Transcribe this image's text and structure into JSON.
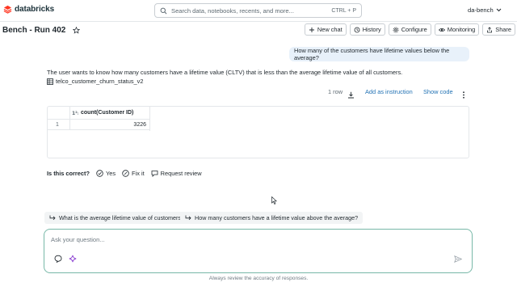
{
  "app": {
    "brand": "databricks",
    "brand_color": "#ff3621",
    "accent_color": "#2272b4"
  },
  "search": {
    "placeholder": "Search data, notebooks, recents, and more...",
    "shortcut": "CTRL + P"
  },
  "workspace": {
    "name": "da-bench",
    "icon": "chevron-down-icon"
  },
  "page": {
    "title": "Bench - Run 402",
    "star_icon": "star-icon"
  },
  "toolbar": {
    "new_chat": "New chat",
    "history": "History",
    "configure": "Configure",
    "monitoring": "Monitoring",
    "share": "Share"
  },
  "chat": {
    "user_question": "How many of the customers have lifetime values below the average?",
    "answer": "The user wants to know how many customers have a lifetime value (CLTV) that is less than the average lifetime value of all customers.",
    "table_ref": "telco_customer_churn_status_v2"
  },
  "result": {
    "row_count": "1 row",
    "add_instruction": "Add as instruction",
    "show_code": "Show code",
    "columns": [
      "count(Customer ID)"
    ],
    "rows": [
      {
        "index": "1",
        "value": "3226"
      }
    ]
  },
  "feedback": {
    "question": "Is this correct?",
    "yes": "Yes",
    "fix": "Fix it",
    "review": "Request review"
  },
  "suggestions": [
    "What is the average lifetime value of customers?",
    "How many customers have a lifetime value above the average?"
  ],
  "composer": {
    "placeholder": "Ask your question..."
  },
  "disclaimer": "Always review the accuracy of responses."
}
